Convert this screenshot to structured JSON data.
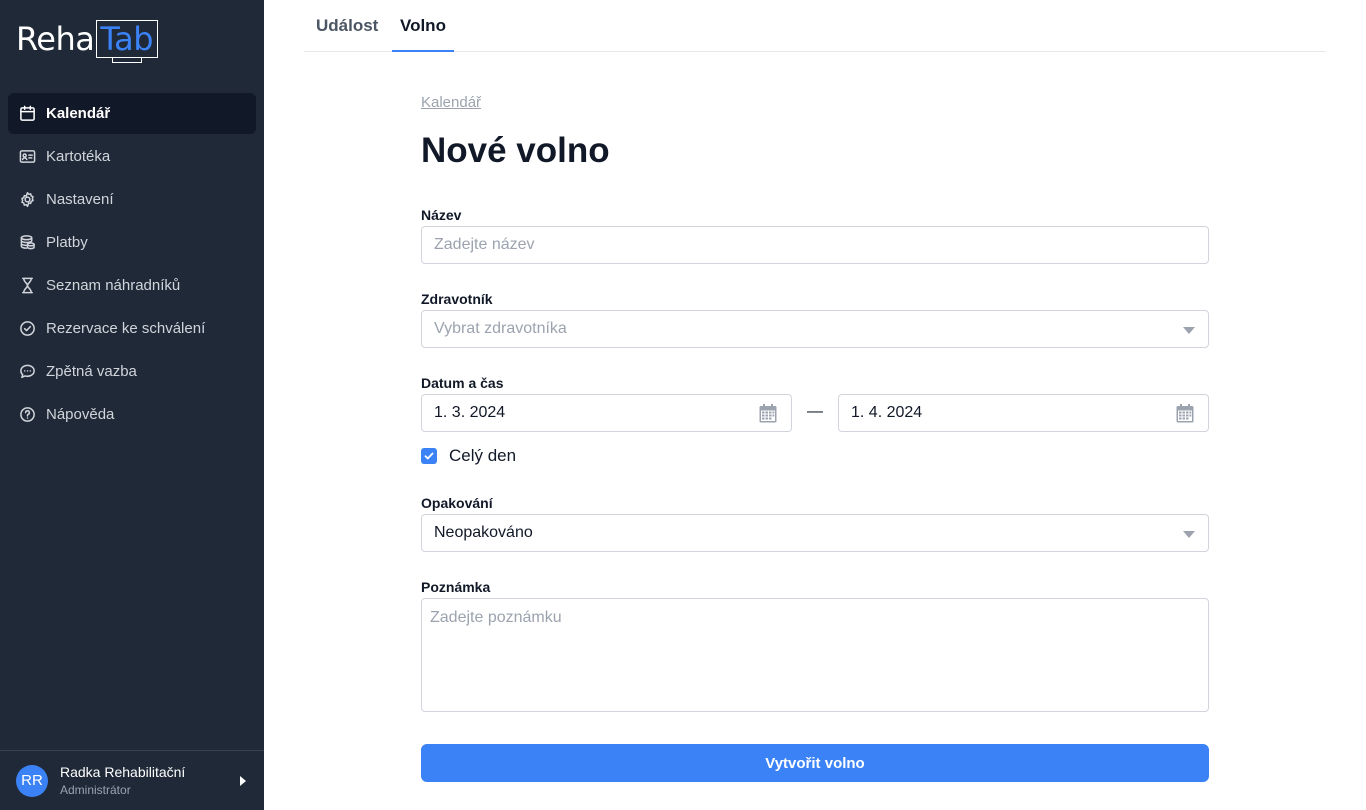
{
  "app": {
    "logo_left": "Reha",
    "logo_right": "Tab"
  },
  "sidebar": {
    "items": [
      {
        "label": "Kalendář",
        "icon": "calendar-icon",
        "active": true
      },
      {
        "label": "Kartotéka",
        "icon": "id-card-icon",
        "active": false
      },
      {
        "label": "Nastavení",
        "icon": "gear-icon",
        "active": false
      },
      {
        "label": "Platby",
        "icon": "coins-icon",
        "active": false
      },
      {
        "label": "Seznam náhradníků",
        "icon": "hourglass-icon",
        "active": false
      },
      {
        "label": "Rezervace ke schválení",
        "icon": "check-circle-icon",
        "active": false
      },
      {
        "label": "Zpětná vazba",
        "icon": "chat-bubble-icon",
        "active": false
      },
      {
        "label": "Nápověda",
        "icon": "help-circle-icon",
        "active": false
      }
    ],
    "user": {
      "initials": "RR",
      "name": "Radka Rehabilitační",
      "role": "Administrátor"
    }
  },
  "tabs": [
    {
      "label": "Událost",
      "active": false
    },
    {
      "label": "Volno",
      "active": true
    }
  ],
  "main": {
    "breadcrumb": "Kalendář",
    "title": "Nové volno",
    "form": {
      "name_label": "Název",
      "name_placeholder": "Zadejte název",
      "worker_label": "Zdravotník",
      "worker_placeholder": "Vybrat zdravotníka",
      "datetime_label": "Datum a čas",
      "date_from": "1. 3. 2024",
      "date_separator": "—",
      "date_to": "1. 4. 2024",
      "all_day_label": "Celý den",
      "all_day_checked": true,
      "repeat_label": "Opakování",
      "repeat_value": "Neopakováno",
      "note_label": "Poznámka",
      "note_placeholder": "Zadejte poznámku",
      "submit_label": "Vytvořit volno"
    }
  },
  "colors": {
    "sidebar_bg": "#1f2937",
    "active_item_bg": "#111827",
    "accent": "#3b82f6"
  }
}
